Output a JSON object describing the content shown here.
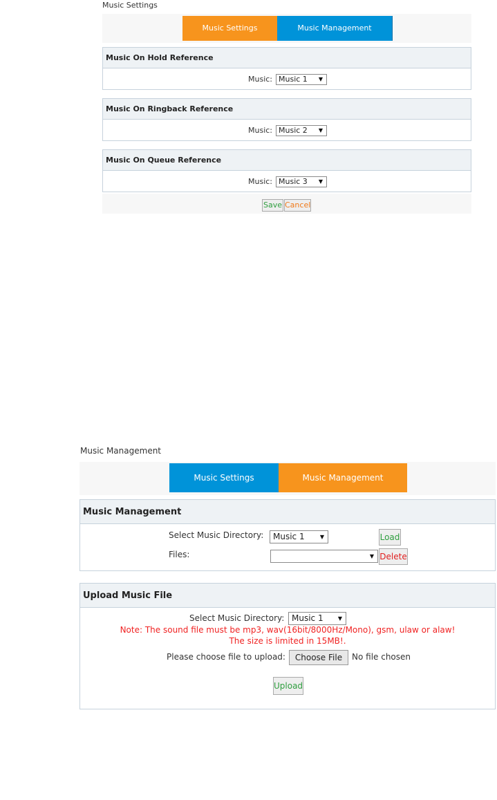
{
  "panel_settings": {
    "title": "Music Settings",
    "tabs": {
      "settings": "Music Settings",
      "management": "Music Management"
    },
    "sections": [
      {
        "header": "Music On Hold Reference",
        "label": "Music:",
        "value": "Music 1"
      },
      {
        "header": "Music On Ringback Reference",
        "label": "Music:",
        "value": "Music 2"
      },
      {
        "header": "Music On Queue Reference",
        "label": "Music:",
        "value": "Music 3"
      }
    ],
    "buttons": {
      "save": "Save",
      "cancel": "Cancel"
    }
  },
  "panel_management": {
    "title": "Music Management",
    "tabs": {
      "settings": "Music Settings",
      "management": "Music Management"
    },
    "management": {
      "header": "Music Management",
      "select_dir_label": "Select Music Directory:",
      "select_dir_value": "Music 1",
      "load": "Load",
      "files_label": "Files:",
      "files_value": "",
      "delete": "Delete"
    },
    "upload": {
      "header": "Upload Music File",
      "select_dir_label": "Select Music Directory:",
      "select_dir_value": "Music 1",
      "note_line1": "Note: The sound file must be mp3, wav(16bit/8000Hz/Mono), gsm, ulaw or alaw!",
      "note_line2": "The size is limited in 15MB!.",
      "choose_label": "Please choose file to upload:",
      "choose_button": "Choose File",
      "no_file": "No file chosen",
      "upload_button": "Upload"
    }
  },
  "colors": {
    "active_tab": "#f7941d",
    "inactive_tab": "#0093d9",
    "section_header_bg": "#eef2f5",
    "note_red": "#f02222",
    "save_green": "#2e9e3e",
    "cancel_orange": "#f07a1a",
    "delete_red": "#e02020"
  },
  "icons": {
    "dropdown": "dropdown-arrow-icon"
  }
}
